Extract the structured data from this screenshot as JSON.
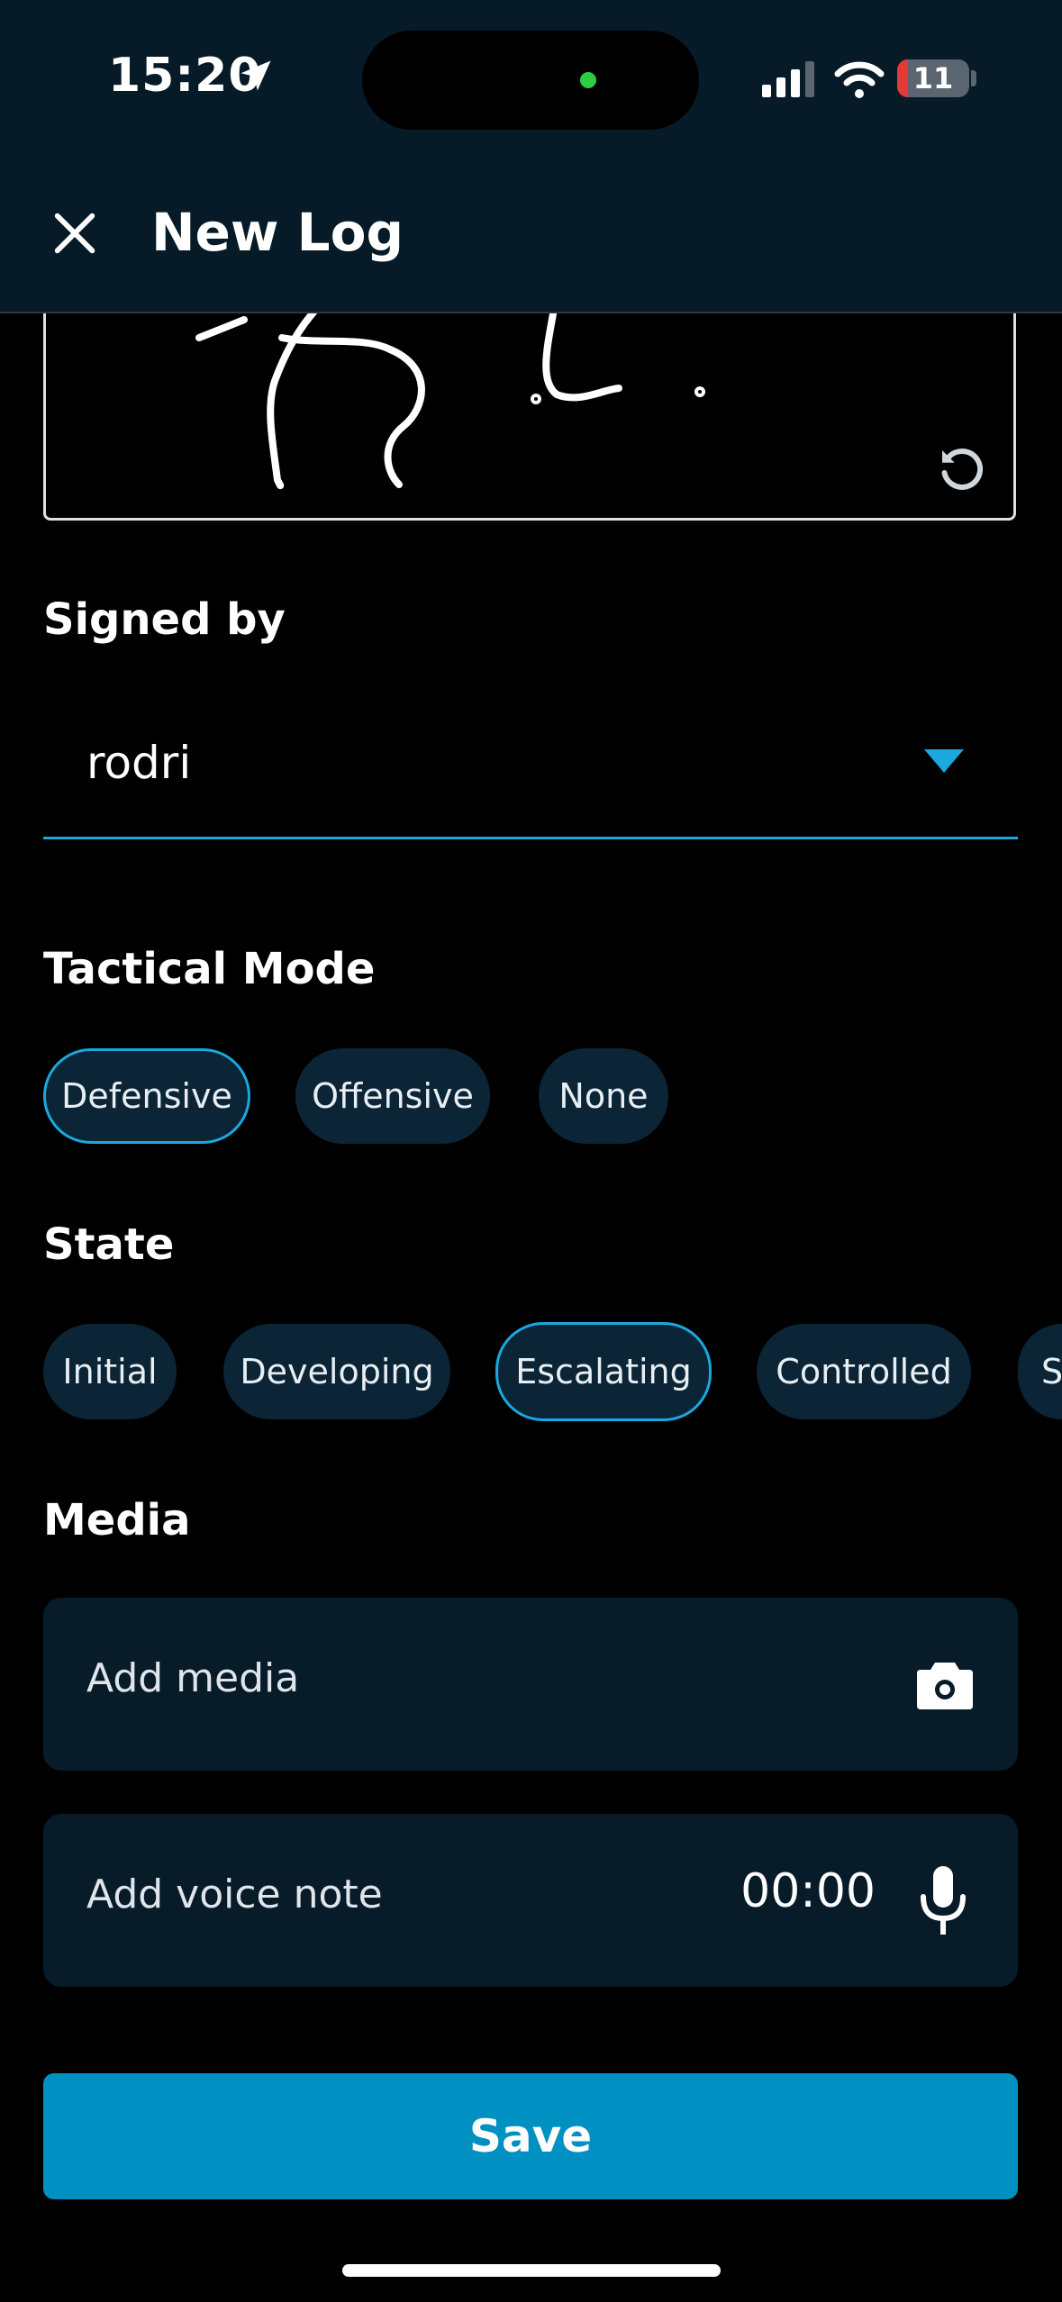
{
  "status_bar": {
    "time": "15:20",
    "battery": "11"
  },
  "header": {
    "title": "New Log"
  },
  "signed_by": {
    "label": "Signed by",
    "value": "rodri"
  },
  "tactical_mode": {
    "label": "Tactical Mode",
    "options": [
      "Defensive",
      "Offensive",
      "None"
    ],
    "selected": "Defensive"
  },
  "state": {
    "label": "State",
    "options": [
      "Initial",
      "Developing",
      "Escalating",
      "Controlled",
      "S"
    ],
    "selected": "Escalating"
  },
  "media": {
    "label": "Media",
    "add_media": "Add media",
    "add_voice": "Add voice note",
    "voice_timer": "00:00"
  },
  "actions": {
    "save": "Save"
  },
  "colors": {
    "accent": "#1aa8de",
    "save_button": "#0091c2",
    "header_bg": "#061a27",
    "chip_bg": "#0b2536"
  }
}
